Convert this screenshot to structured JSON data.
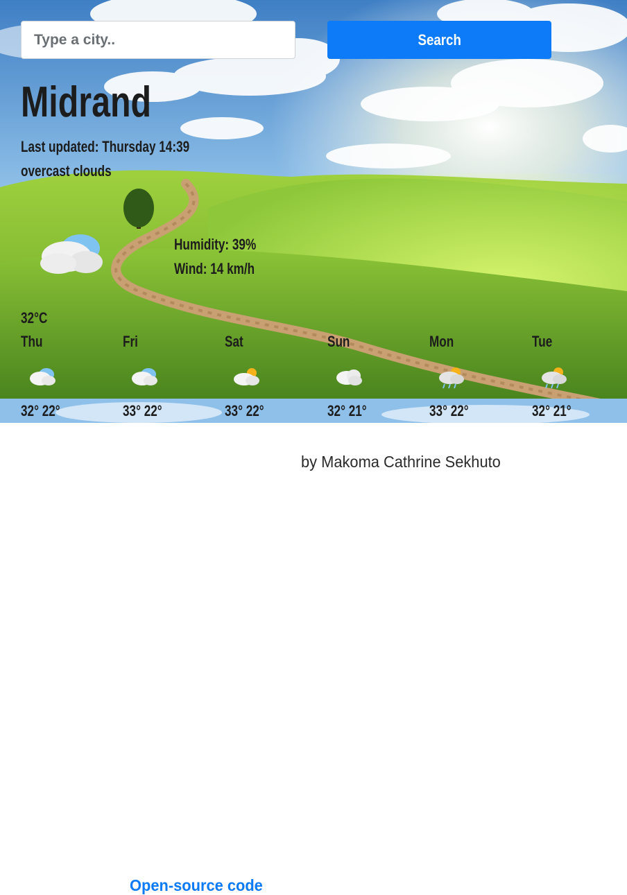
{
  "search": {
    "placeholder": "Type a city..",
    "button_label": "Search"
  },
  "current": {
    "city": "Midrand",
    "last_updated": "Last updated: Thursday 14:39",
    "description": "overcast clouds",
    "humidity": "Humidity: 39%",
    "wind": "Wind: 14 km/h",
    "temperature": "32°C",
    "icon": "cloud-icon"
  },
  "forecast": [
    {
      "day": "Thu",
      "temps": "32° 22°",
      "icon": "cloud-icon"
    },
    {
      "day": "Fri",
      "temps": "33° 22°",
      "icon": "cloud-icon"
    },
    {
      "day": "Sat",
      "temps": "33° 22°",
      "icon": "partly-sunny-icon"
    },
    {
      "day": "Sun",
      "temps": "32° 21°",
      "icon": "cloud-icon"
    },
    {
      "day": "Mon",
      "temps": "33° 22°",
      "icon": "sun-rain-icon"
    },
    {
      "day": "Tue",
      "temps": "32° 21°",
      "icon": "sun-rain-icon"
    }
  ],
  "footer": {
    "link_text": "Open-source code",
    "credit": "by Makoma Cathrine Sekhuto"
  },
  "colors": {
    "accent": "#0d7bf8",
    "text": "#1c1c1c",
    "sky": "#6fa8dc",
    "grass": "#7cb82f"
  }
}
